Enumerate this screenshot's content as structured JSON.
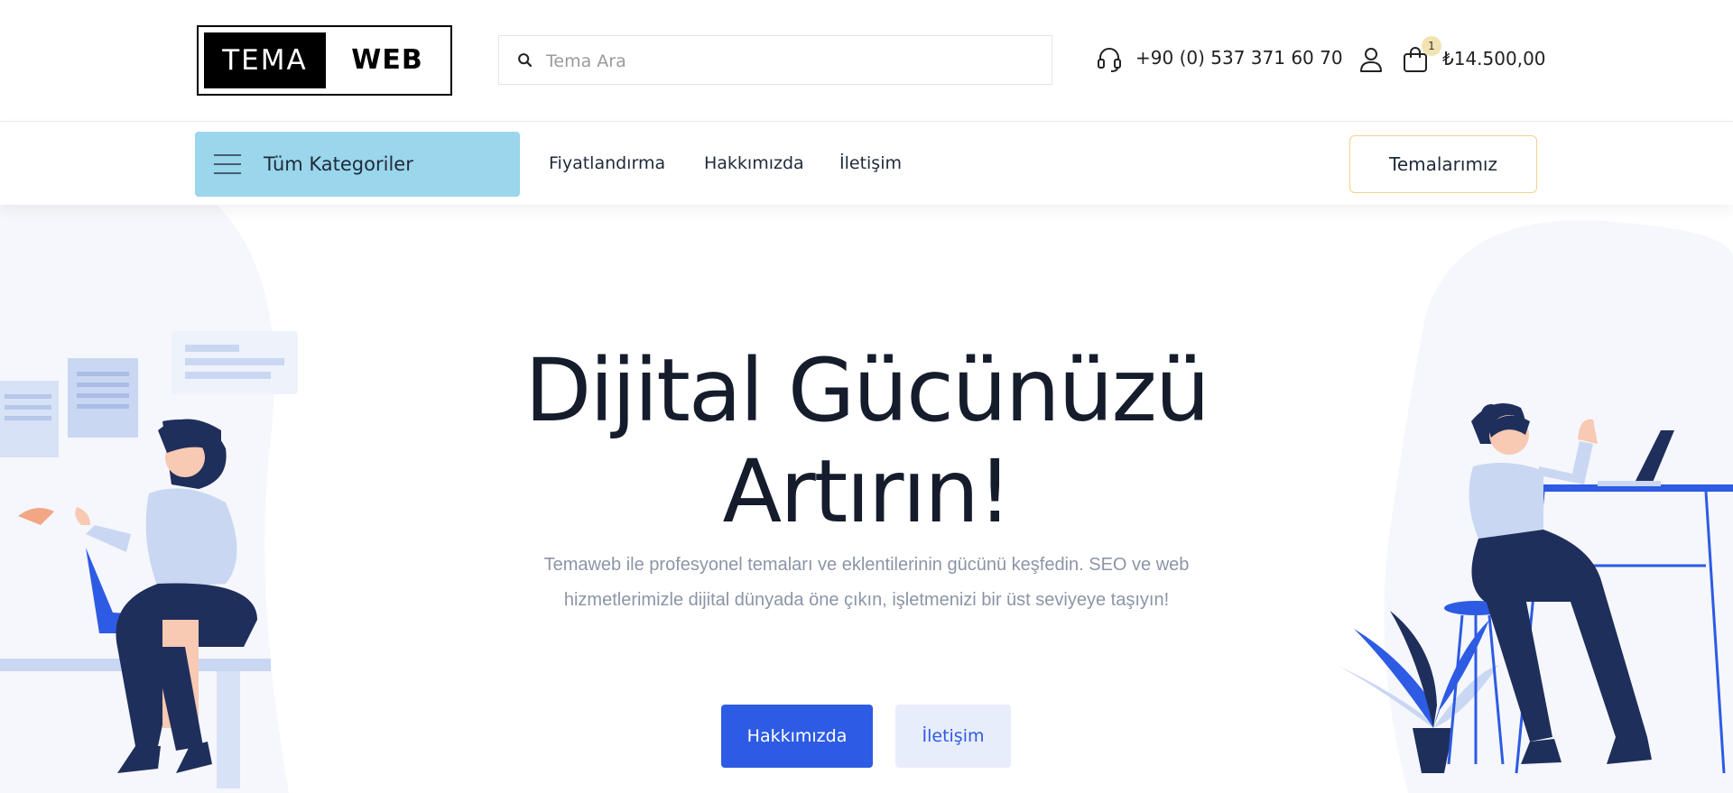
{
  "brand": {
    "logo_left": "TEMA",
    "logo_right": "WEB"
  },
  "search": {
    "placeholder": "Tema Ara",
    "value": ""
  },
  "contact": {
    "phone": "+90 (0) 537 371 60 70"
  },
  "cart": {
    "count": "1",
    "total": "₺14.500,00"
  },
  "nav": {
    "categories_label": "Tüm Kategoriler",
    "links": [
      "Fiyatlandırma",
      "Hakkımızda",
      "İletişim"
    ],
    "themes_button": "Temalarımız"
  },
  "hero": {
    "title_line1": "Dijital Gücünüzü",
    "title_line2": "Artırın!",
    "subtitle": "Temaweb ile profesyonel temaları ve eklentilerinin gücünü keşfedin. SEO ve web hizmetlerimizle dijital dünyada öne çıkın, işletmenizi bir üst seviyeye taşıyın!",
    "primary_button": "Hakkımızda",
    "secondary_button": "İletişim"
  },
  "colors": {
    "primary": "#2d5be3",
    "categories_bg": "#9ad6ec",
    "themes_border": "#f2d28e",
    "illustration_navy": "#1f2f5c",
    "illustration_light": "#c9d7f2"
  },
  "icons": {
    "search": "search-icon",
    "phone": "headset-icon",
    "user": "user-icon",
    "cart": "shopping-bag-icon",
    "menu": "hamburger-menu-icon"
  }
}
